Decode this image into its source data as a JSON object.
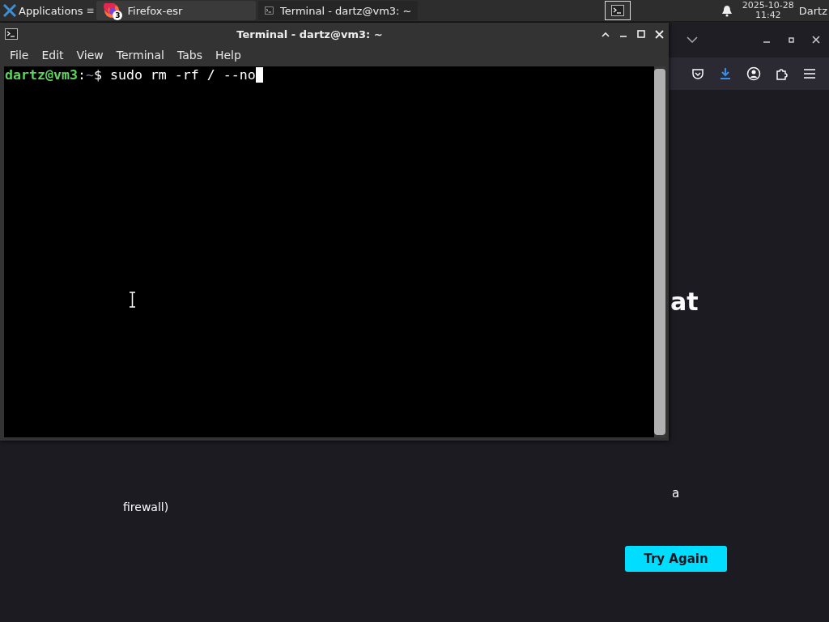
{
  "taskbar": {
    "apps_menu": {
      "label": "Applications",
      "menu_glyph": "≡"
    },
    "tasks": [
      {
        "kind": "firefox",
        "label": "Firefox-esr",
        "badge": "3",
        "selected": false
      },
      {
        "kind": "terminal",
        "label": "Terminal - dartz@vm3: ~",
        "selected": true
      }
    ],
    "clock": {
      "date": "2025-10-28",
      "time": "11:42"
    },
    "user": "Dartz"
  },
  "browser": {
    "page": {
      "heading_fragment": "at",
      "text_fragment": "a",
      "caption_fragment": "firewall)",
      "button": "Try Again"
    }
  },
  "terminal": {
    "title": "Terminal - dartz@vm3: ~",
    "menu": [
      "File",
      "Edit",
      "View",
      "Terminal",
      "Tabs",
      "Help"
    ],
    "prompt": {
      "user_host": "dartz@vm3",
      "separator": ":",
      "path": "~",
      "symbol": "$"
    },
    "command": "sudo rm -rf / --no"
  }
}
